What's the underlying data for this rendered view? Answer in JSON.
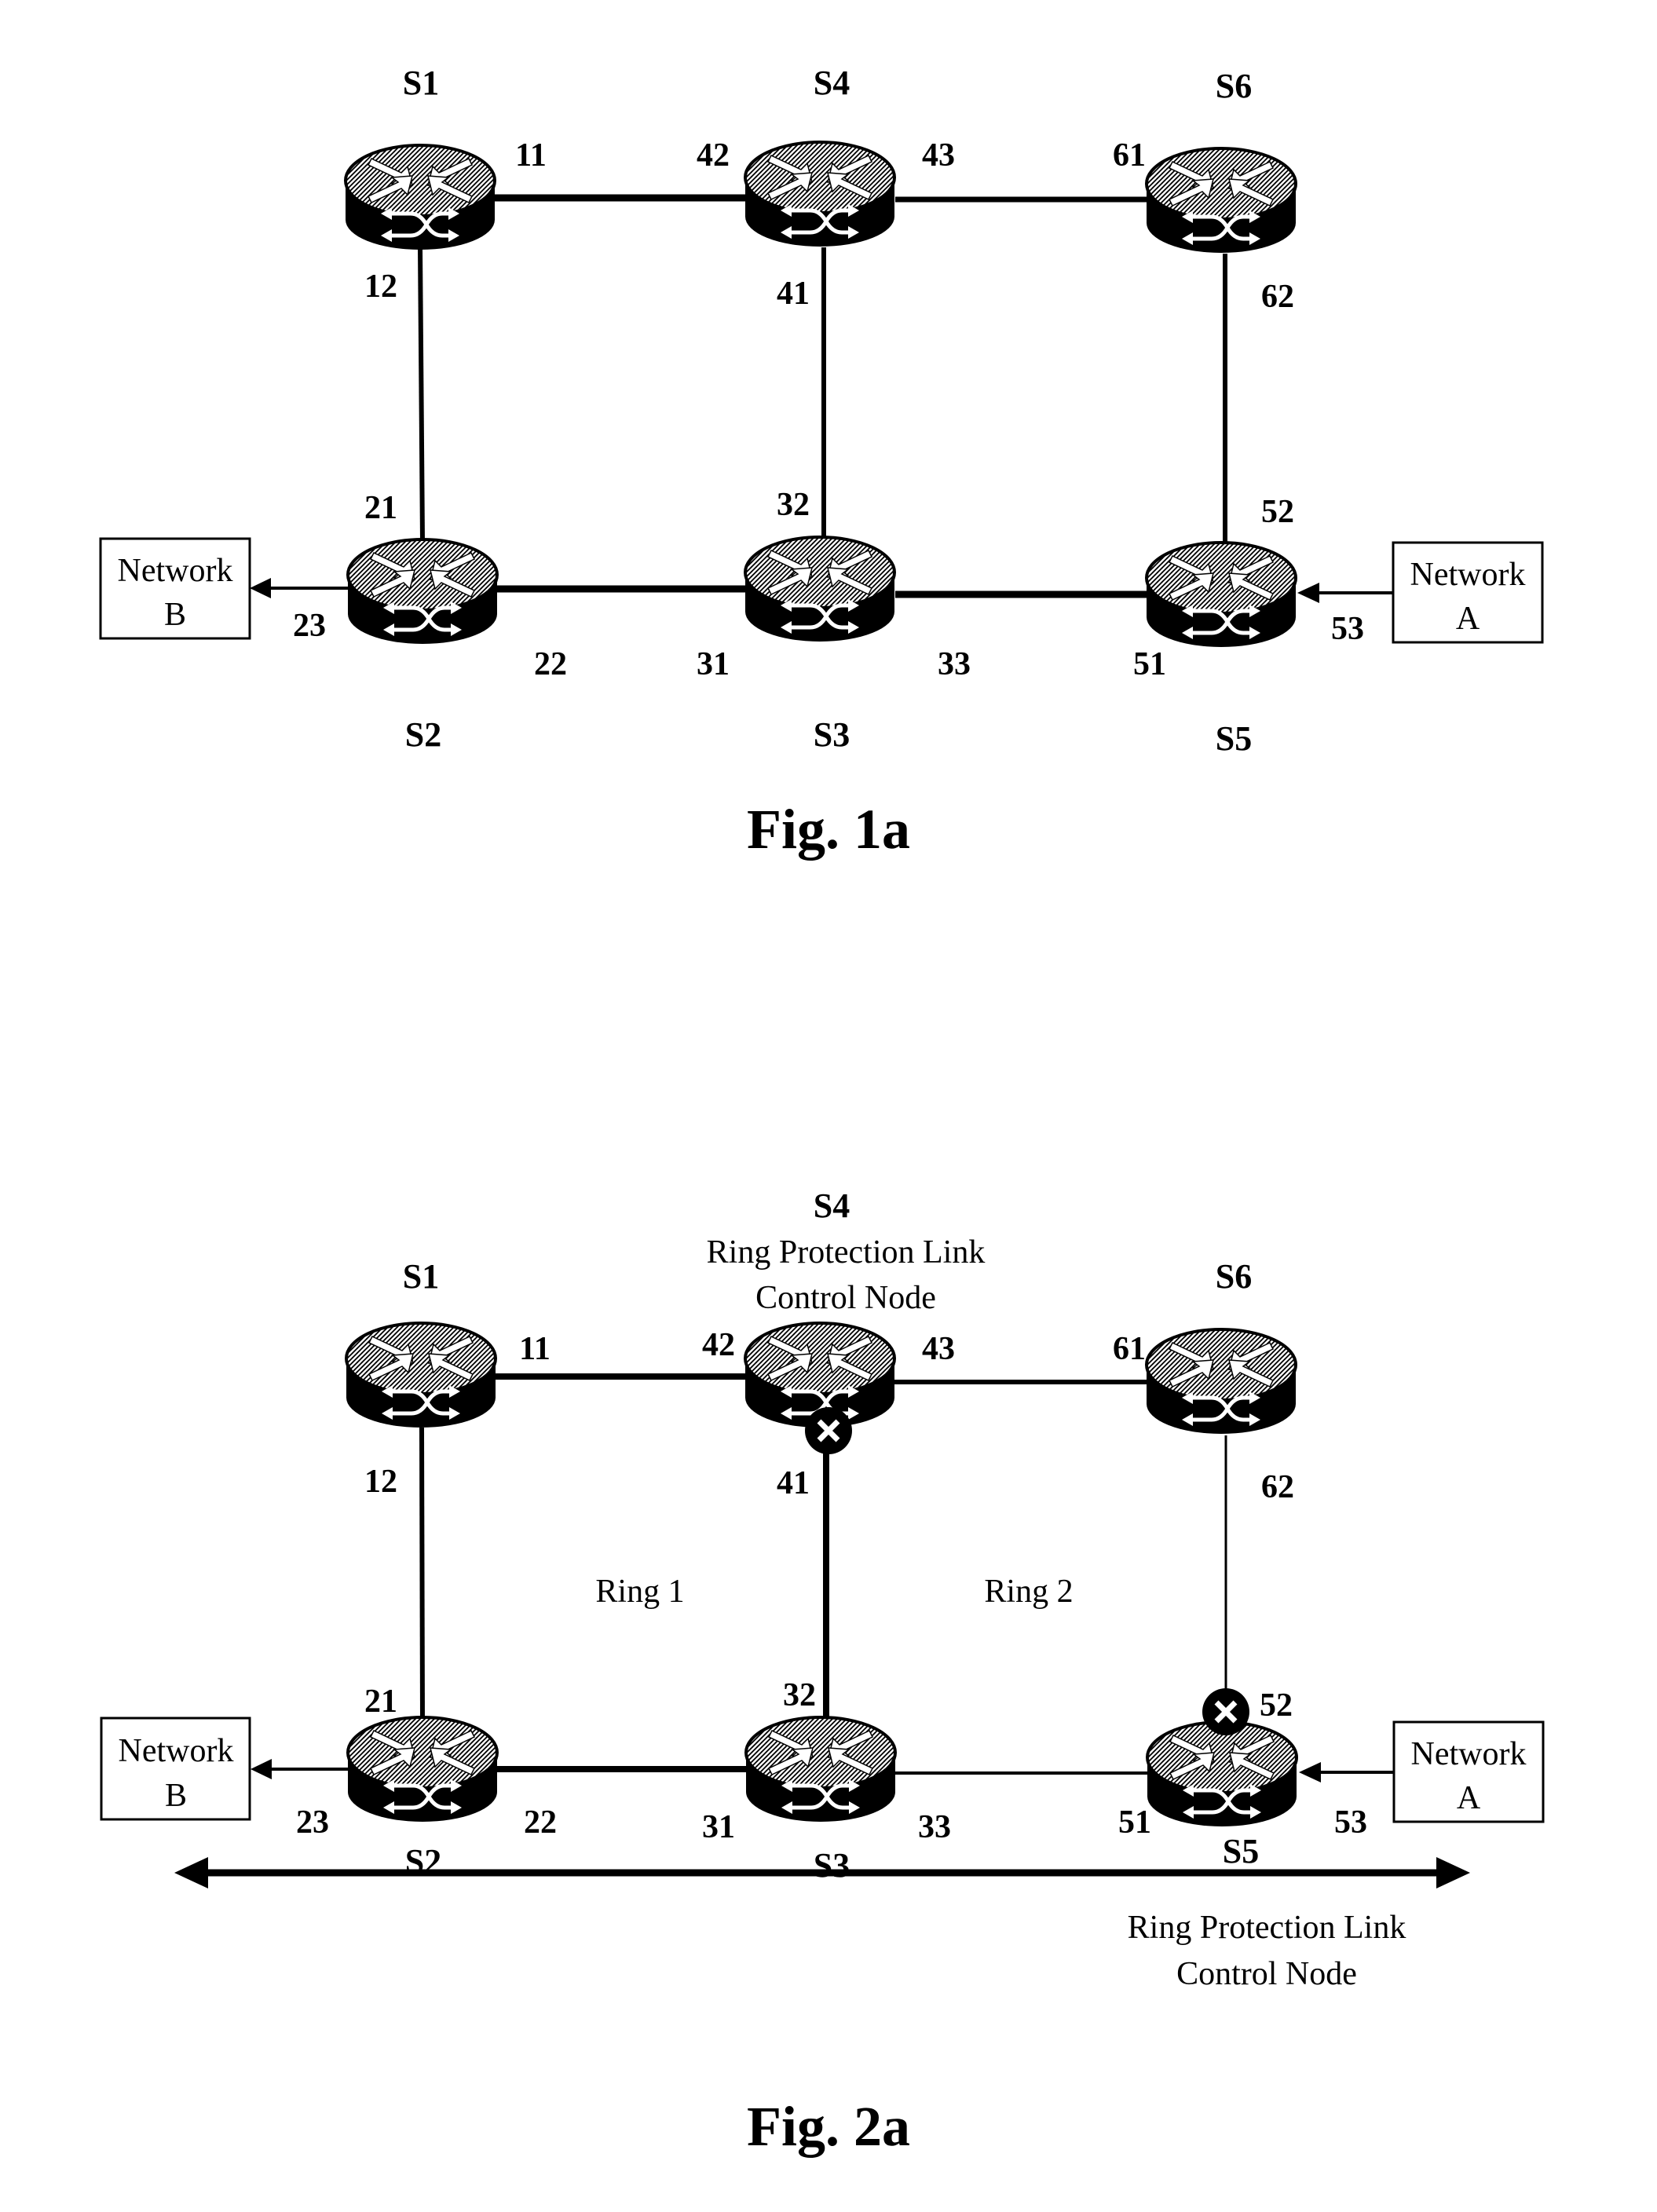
{
  "figures": [
    {
      "id": "fig1a",
      "caption": "Fig. 1a",
      "nodes": {
        "S1": {
          "label": "S1",
          "icon": "router-switch-icon"
        },
        "S2": {
          "label": "S2",
          "icon": "router-switch-icon"
        },
        "S3": {
          "label": "S3",
          "icon": "router-switch-icon"
        },
        "S4": {
          "label": "S4",
          "icon": "router-switch-icon"
        },
        "S5": {
          "label": "S5",
          "icon": "router-switch-icon"
        },
        "S6": {
          "label": "S6",
          "icon": "router-switch-icon"
        }
      },
      "ports": {
        "p11": "11",
        "p12": "12",
        "p21": "21",
        "p22": "22",
        "p23": "23",
        "p31": "31",
        "p32": "32",
        "p33": "33",
        "p41": "41",
        "p42": "42",
        "p43": "43",
        "p51": "51",
        "p52": "52",
        "p53": "53",
        "p61": "61",
        "p62": "62"
      },
      "networks": {
        "B": {
          "line1": "Network",
          "line2": "B"
        },
        "A": {
          "line1": "Network",
          "line2": "A"
        }
      },
      "links": [
        {
          "from": "S1",
          "to": "S4",
          "ports": [
            "11",
            "42"
          ]
        },
        {
          "from": "S4",
          "to": "S6",
          "ports": [
            "43",
            "61"
          ]
        },
        {
          "from": "S1",
          "to": "S2",
          "ports": [
            "12",
            "21"
          ]
        },
        {
          "from": "S4",
          "to": "S3",
          "ports": [
            "41",
            "32"
          ]
        },
        {
          "from": "S6",
          "to": "S5",
          "ports": [
            "62",
            "52"
          ]
        },
        {
          "from": "S2",
          "to": "S3",
          "ports": [
            "22",
            "31"
          ]
        },
        {
          "from": "S3",
          "to": "S5",
          "ports": [
            "33",
            "51"
          ]
        },
        {
          "from": "Network A",
          "to": "S5",
          "ports": [
            "53"
          ],
          "directed": true
        },
        {
          "from": "S2",
          "to": "Network B",
          "ports": [
            "23"
          ],
          "directed": true
        }
      ]
    },
    {
      "id": "fig2a",
      "caption": "Fig. 2a",
      "nodes": {
        "S1": {
          "label": "S1",
          "icon": "router-switch-icon"
        },
        "S2": {
          "label": "S2",
          "icon": "router-switch-icon"
        },
        "S3": {
          "label": "S3",
          "icon": "router-switch-icon"
        },
        "S4": {
          "label": "S4",
          "icon": "router-switch-icon",
          "role": "Ring Protection Link Control Node"
        },
        "S5": {
          "label": "S5",
          "icon": "router-switch-icon",
          "role": "Ring Protection Link Control Node"
        },
        "S6": {
          "label": "S6",
          "icon": "router-switch-icon"
        }
      },
      "role_text": {
        "line1": "Ring Protection Link",
        "line2": "Control Node"
      },
      "rings": {
        "ring1": "Ring 1",
        "ring2": "Ring 2"
      },
      "blocked_ports": [
        "41",
        "52"
      ],
      "blocked_port_icon": "blocked-port-x-icon",
      "ports": {
        "p11": "11",
        "p12": "12",
        "p21": "21",
        "p22": "22",
        "p23": "23",
        "p31": "31",
        "p32": "32",
        "p33": "33",
        "p41": "41",
        "p42": "42",
        "p43": "43",
        "p51": "51",
        "p52": "52",
        "p53": "53",
        "p61": "61",
        "p62": "62"
      },
      "networks": {
        "B": {
          "line1": "Network",
          "line2": "B"
        },
        "A": {
          "line1": "Network",
          "line2": "A"
        }
      },
      "double_arrow": "double-headed-arrow-icon"
    }
  ]
}
